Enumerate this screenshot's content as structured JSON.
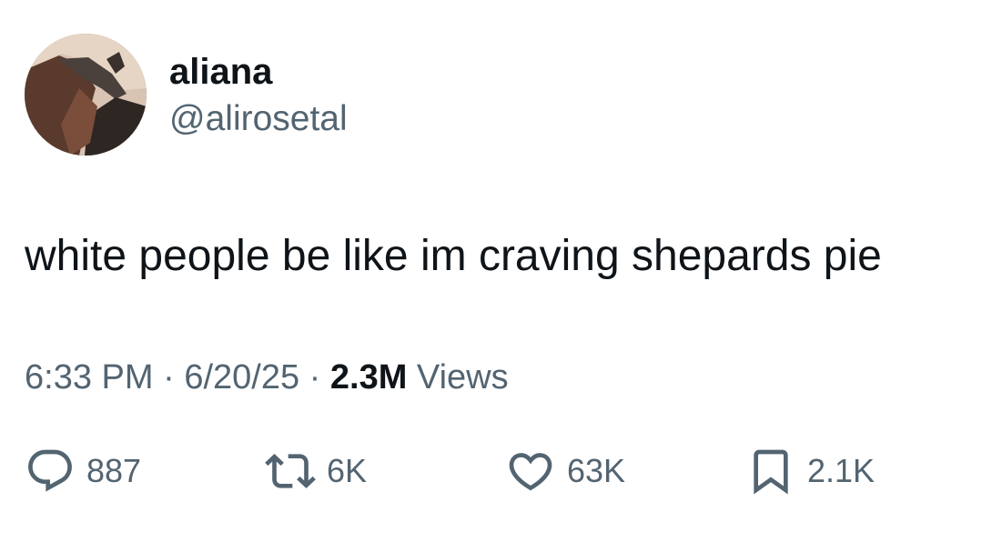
{
  "author": {
    "display_name": "aliana",
    "handle": "@alirosetal"
  },
  "tweet": {
    "text": "white people be like im craving shepards pie"
  },
  "meta": {
    "time": "6:33 PM",
    "separator": " · ",
    "date": "6/20/25",
    "views_count": "2.3M",
    "views_label": " Views"
  },
  "actions": {
    "replies": "887",
    "reposts": "6K",
    "likes": "63K",
    "bookmarks": "2.1K"
  },
  "colors": {
    "text_primary": "#0f1419",
    "text_secondary": "#536471",
    "background": "#ffffff"
  },
  "icons": {
    "reply": "reply-icon",
    "repost": "repost-icon",
    "like": "heart-icon",
    "bookmark": "bookmark-icon"
  }
}
